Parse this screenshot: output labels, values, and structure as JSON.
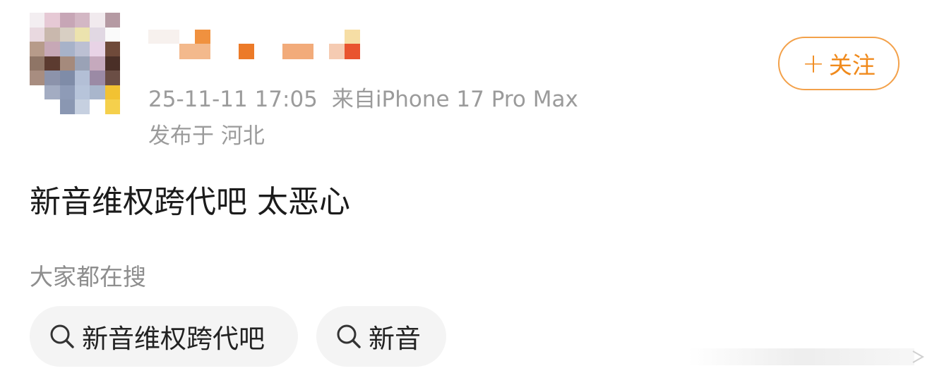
{
  "post": {
    "meta_time": "25-11-11 17:05",
    "meta_source": "来自iPhone 17 Pro Max",
    "meta_location": "发布于 河北",
    "text": "新音维权跨代吧 太恶心"
  },
  "follow_button": {
    "plus": "+",
    "label": "关注",
    "accent": "#f08a1c"
  },
  "search": {
    "title": "大家都在搜",
    "chips": [
      {
        "label": "新音维权跨代吧",
        "icon": "search-icon"
      },
      {
        "label": "新音",
        "icon": "search-icon"
      }
    ]
  },
  "colors": {
    "meta_gray": "#9b9b9b",
    "chip_bg": "#f4f4f4",
    "follow_border": "#f3a14a"
  }
}
